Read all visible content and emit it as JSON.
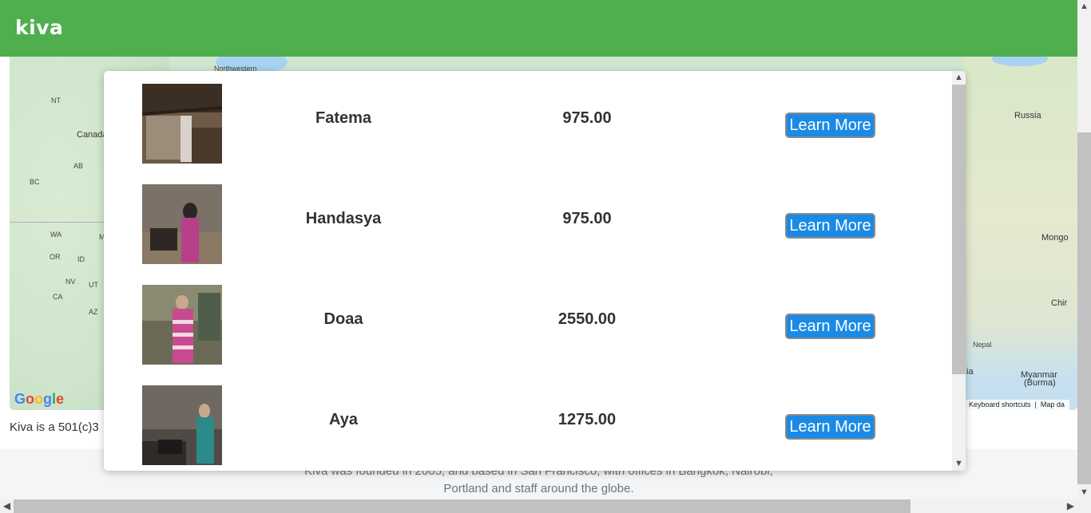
{
  "header": {
    "logo_text": "kiva"
  },
  "map": {
    "labels": {
      "nt": "NT",
      "canada": "Canada",
      "ab": "AB",
      "bc": "BC",
      "wa": "WA",
      "or": "OR",
      "id": "ID",
      "nv": "NV",
      "ut": "UT",
      "ca": "CA",
      "az": "AZ",
      "m": "M",
      "northwestern": "Northwestern",
      "russia": "Russia",
      "mongolia": "Mongo",
      "china": "Chir",
      "nepal": "Nepal",
      "ia": "ia",
      "myanmar": "Myanmar",
      "burma": "(Burma)"
    },
    "google_letters": [
      "G",
      "o",
      "o",
      "g",
      "l",
      "e"
    ],
    "keyboard_shortcuts": "Keyboard shortcuts",
    "map_data": "Map da"
  },
  "about_text": "Kiva is a 501(c)3",
  "footer": {
    "line1": "Kiva was founded in 2005, and based in San Francisco, with offices in Bangkok, Nairobi,",
    "line2": "Portland and staff around the globe."
  },
  "loans": [
    {
      "name": "Fatema",
      "amount": "975.00",
      "button": "Learn More"
    },
    {
      "name": "Handasya",
      "amount": "975.00",
      "button": "Learn More"
    },
    {
      "name": "Doaa",
      "amount": "2550.00",
      "button": "Learn More"
    },
    {
      "name": "Aya",
      "amount": "1275.00",
      "button": "Learn More"
    }
  ],
  "colors": {
    "brand_green": "#4fae4e",
    "button_blue": "#1a8ae6"
  },
  "icons": {
    "scroll_up": "▲",
    "scroll_down": "▼",
    "scroll_left": "◀",
    "scroll_right": "▶"
  }
}
